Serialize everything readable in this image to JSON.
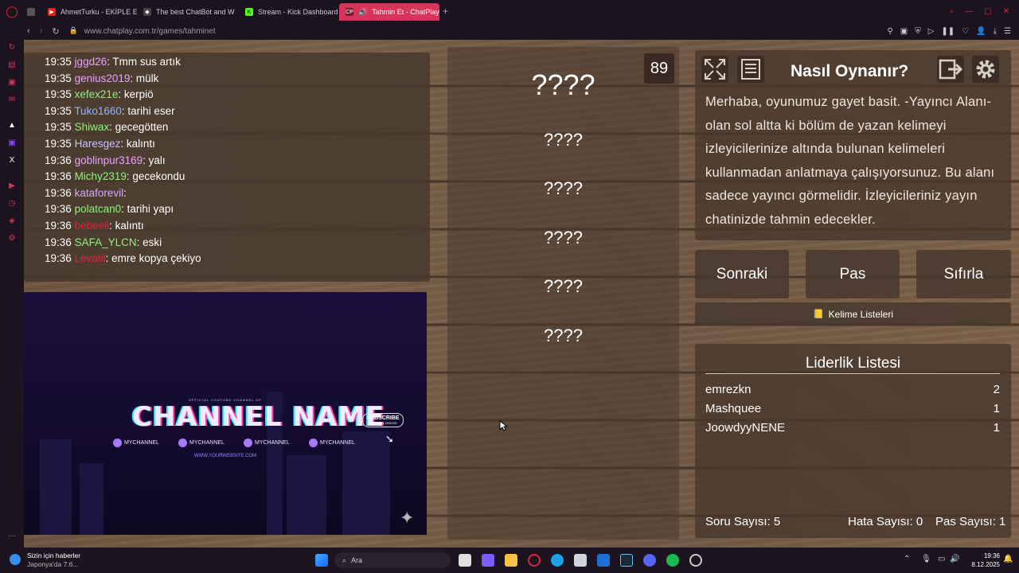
{
  "browser": {
    "tabs": [
      {
        "label": "AhmetTurku - EKİPLE ESK",
        "color": "#e62117"
      },
      {
        "label": "The best ChatBot and W",
        "color": "#cccccc"
      },
      {
        "label": "Stream - Kick Dashboard",
        "color": "#53fc18"
      },
      {
        "label": "Tahmin Et - ChatPlay",
        "color": "#ffffff",
        "active": true
      }
    ],
    "url": "www.chatplay.com.tr/games/tahminet"
  },
  "chat": {
    "messages": [
      {
        "time": "19:35",
        "user": "jggd26",
        "text": ": Tmm sus artık",
        "color": "#e9a0ff"
      },
      {
        "time": "19:35",
        "user": "genius2019",
        "text": ": mülk",
        "color": "#e9a0ff"
      },
      {
        "time": "19:35",
        "user": "xefex21e",
        "text": ": kerpiö",
        "color": "#8df27a"
      },
      {
        "time": "19:35",
        "user": "Tuko1660",
        "text": ": tarihi eser",
        "color": "#8fb4ff"
      },
      {
        "time": "19:35",
        "user": "Shiwax",
        "text": ": gecegötten",
        "color": "#8df27a"
      },
      {
        "time": "19:35",
        "user": "Haresgez",
        "text": ": kalıntı",
        "color": "#c8c0ff"
      },
      {
        "time": "19:36",
        "user": "goblinpur3169",
        "text": ": yalı",
        "color": "#e9a0ff"
      },
      {
        "time": "19:36",
        "user": "Michy2319",
        "text": ": gecekondu",
        "color": "#8df27a"
      },
      {
        "time": "19:36",
        "user": "kataforevil",
        "text": ":",
        "color": "#d2a8ff"
      },
      {
        "time": "19:36",
        "user": "polatcan0",
        "text": ": tarihi yapı",
        "color": "#8df27a"
      },
      {
        "time": "19:36",
        "user": "bebeeli",
        "text": ": kalıntı",
        "color": "#e0233a"
      },
      {
        "time": "19:36",
        "user": "SAFA_YLCN",
        "text": ": eski",
        "color": "#8df27a"
      },
      {
        "time": "19:36",
        "user": "Levatil",
        "text": ": emre kopya çekiyo",
        "color": "#e0233a"
      }
    ]
  },
  "video": {
    "top_line": "OFFICIAL YOUTUBE CHANNEL OF",
    "channel": "CHANNEL NAME",
    "socials": [
      "MYCHANNEL",
      "MYCHANNEL",
      "MYCHANNEL",
      "MYCHANNEL"
    ],
    "website": "WWW.YOURWEBSITE.COM",
    "subscribe": "SUBSCRIBE",
    "subscribe_sub": "FOR NEW VIDEOS"
  },
  "game": {
    "timer": "89",
    "words": [
      "????",
      "????",
      "????",
      "????",
      "????",
      "????"
    ]
  },
  "howto": {
    "title": "Nasıl Oynanır?",
    "text": "Merhaba, oyunumuz gayet basit. -Yayıncı Alanı- olan sol altta ki bölüm de yazan kelimeyi izleyicilerinize altında bulunan kelimeleri kullanmadan anlatmaya çalışıyorsunuz. Bu alanı sadece yayıncı görmelidir. İzleyicileriniz yayın chatinizde tahmin edecekler."
  },
  "buttons": {
    "next": "Sonraki",
    "pass": "Pas",
    "reset": "Sıfırla",
    "word_lists": "Kelime Listeleri"
  },
  "leaderboard": {
    "title": "Liderlik Listesi",
    "rows": [
      {
        "name": "emrezkn",
        "score": "2"
      },
      {
        "name": "Mashquee",
        "score": "1"
      },
      {
        "name": "JoowdyyNENE",
        "score": "1"
      }
    ],
    "stats": {
      "questions": "Soru Sayısı: 5",
      "errors": "Hata Sayısı: 0",
      "passes": "Pas Sayısı: 1"
    }
  },
  "taskbar": {
    "news_title": "Sizin için haberler",
    "news_sub": "Japonya'da 7.6...",
    "search": "Ara",
    "time": "19:36",
    "date": "8.12.2025"
  },
  "colors": {
    "accent": "#d8335a",
    "wood": "#76604a"
  }
}
